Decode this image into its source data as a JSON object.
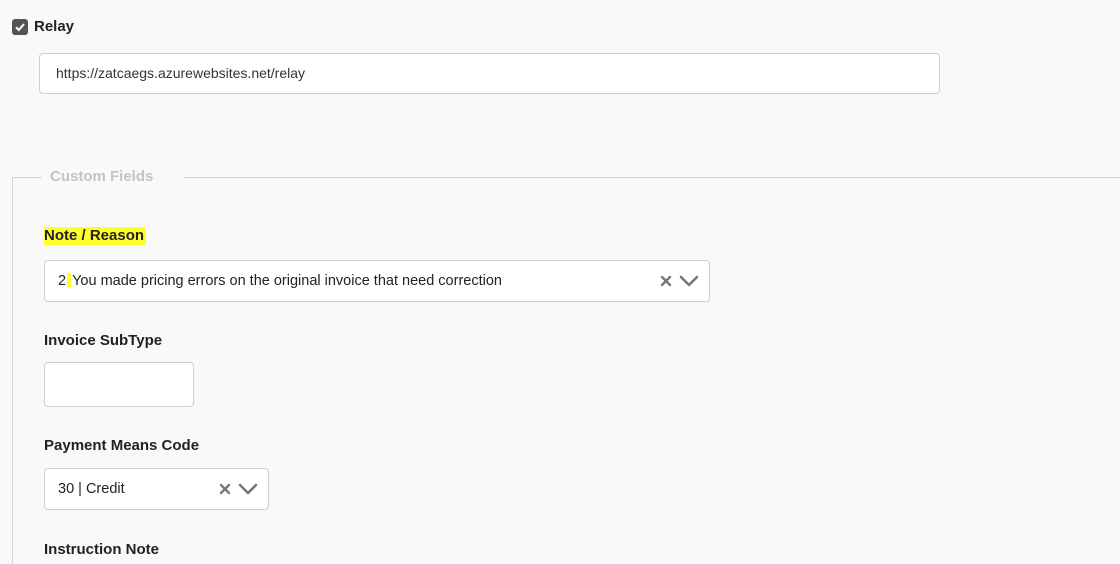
{
  "relay": {
    "checked": true,
    "label": "Relay",
    "url": "https://zatcaegs.azurewebsites.net/relay"
  },
  "custom_fields": {
    "legend": "Custom Fields",
    "note_reason": {
      "label": "Note / Reason",
      "value_prefix": "2",
      "value_text": "You made pricing errors on the original invoice that need correction"
    },
    "invoice_subtype": {
      "label": "Invoice SubType",
      "value": ""
    },
    "payment_means_code": {
      "label": "Payment Means Code",
      "value": "30 | Credit"
    },
    "instruction_note": {
      "label": "Instruction Note"
    }
  },
  "colors": {
    "highlight": "#ffff2e",
    "checkbox": "#555555",
    "border": "#cfcfcf"
  },
  "icons": [
    "check-icon",
    "clear-icon",
    "chevron-down-icon"
  ]
}
